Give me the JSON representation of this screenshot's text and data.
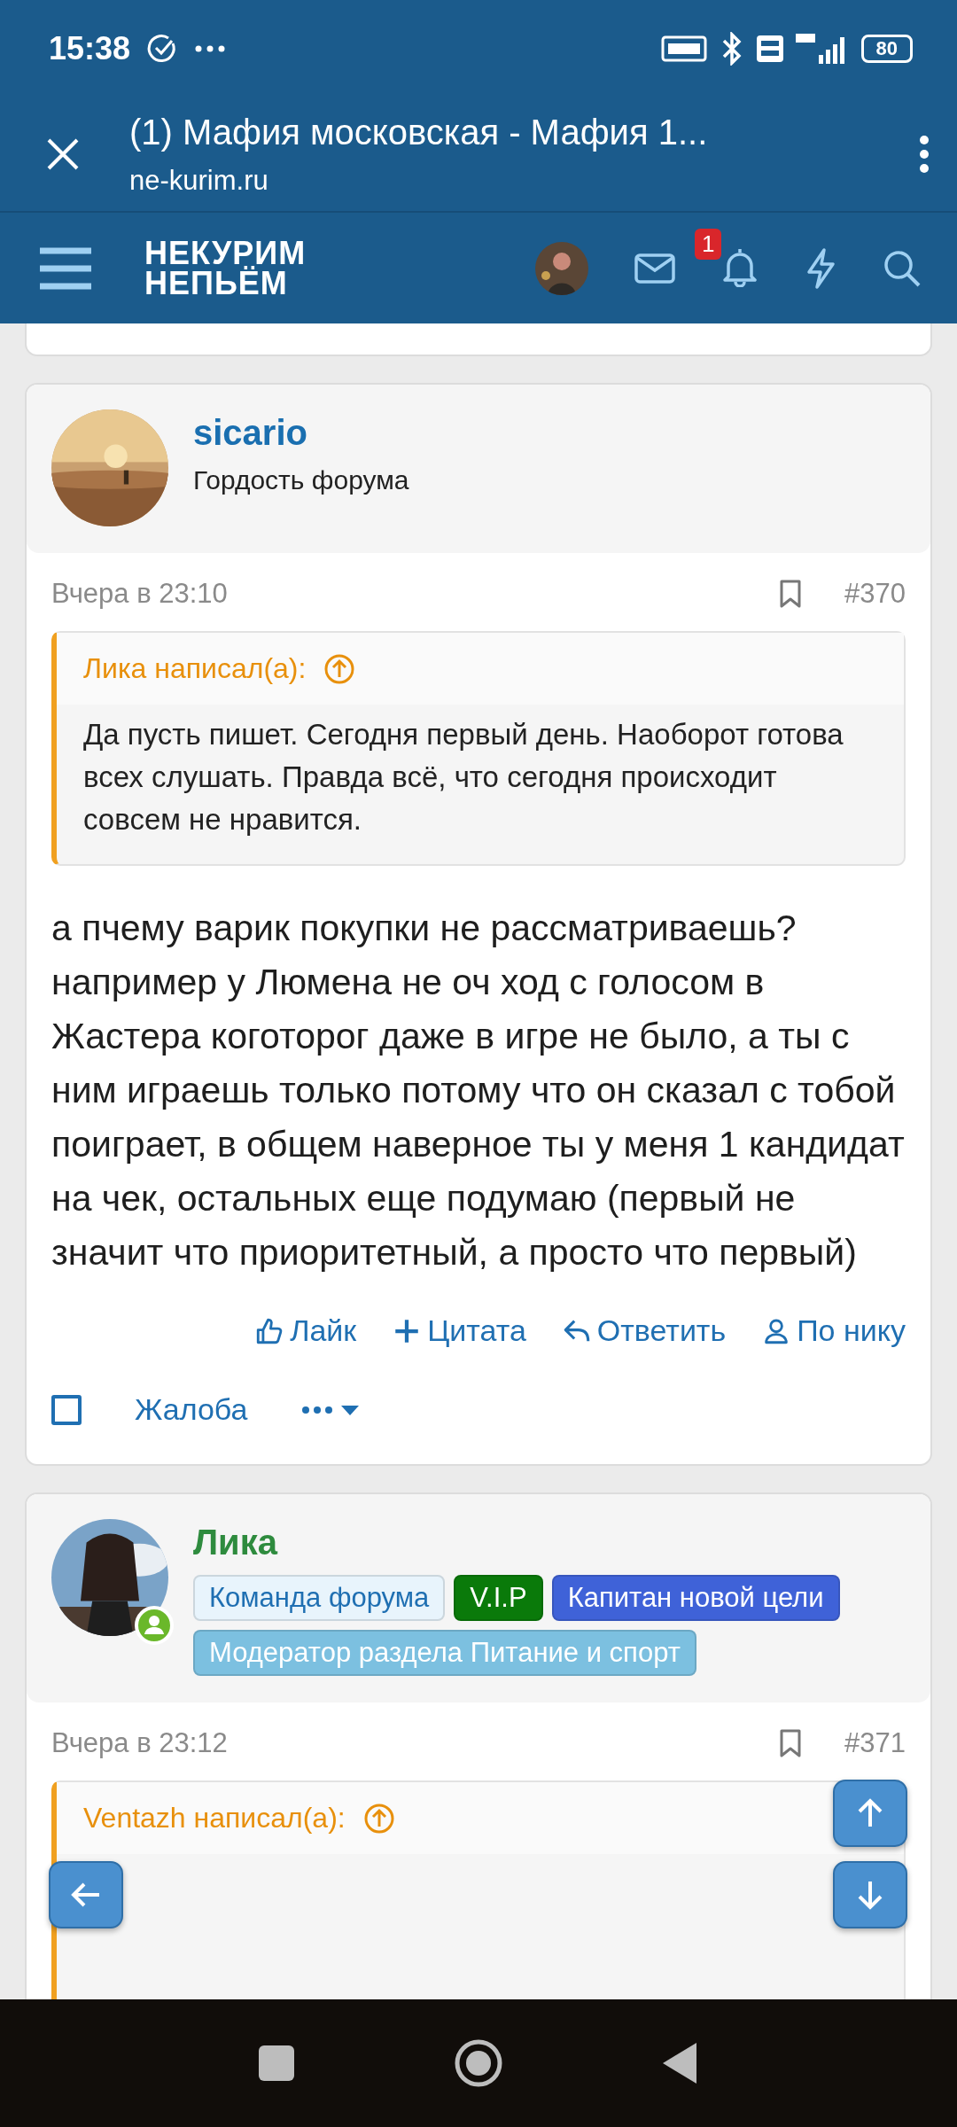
{
  "status_bar": {
    "time": "15:38",
    "battery": "80"
  },
  "browser": {
    "title": "(1) Мафия московская - Мафия 1...",
    "url": "ne-kurim.ru"
  },
  "site_nav": {
    "logo_line1": "НЕКУРИМ",
    "logo_line2": "НЕПЬЁМ",
    "notification_count": "1"
  },
  "posts": [
    {
      "author": "sicario",
      "color": "#1a6fb0",
      "online": false,
      "title": "Гордость форума",
      "date": "Вчера в 23:10",
      "number": "#370",
      "quote": {
        "author": "Лика написал(а):",
        "text": "Да пусть пишет. Сегодня первый день. Наоборот готова всех слушать. Правда всё, что сегодня происходит совсем не нравится."
      },
      "body": "а пчему варик покупки не рассматриваешь? например у Люмена не оч ход с голосом в Жастера коготорог даже в игре не было, а ты с ним играешь только потому что он сказал с тобой поиграет, в общем наверное ты у меня 1 кандидат на чек, остальных еще подумаю (первый не значит что приоритетный, а просто что первый)",
      "actions": [
        "Лайк",
        "Цитата",
        "Ответить",
        "По нику"
      ],
      "report": "Жалоба",
      "checked": false
    },
    {
      "author": "Лика",
      "color": "#2e8b3e",
      "online": true,
      "badges": [
        {
          "label": "Команда форума",
          "color": "#e8f4fc"
        },
        {
          "label": "V.I.P",
          "color": "#0a7a0a"
        },
        {
          "label": "Капитан новой цели",
          "color": "#3f62d8"
        },
        {
          "label": "Модератор раздела Питание и спорт",
          "color": "#7cc0e0"
        }
      ],
      "date": "Вчера в 23:12",
      "number": "#371",
      "quote": {
        "author": "Ventazh написал(а):"
      }
    }
  ]
}
